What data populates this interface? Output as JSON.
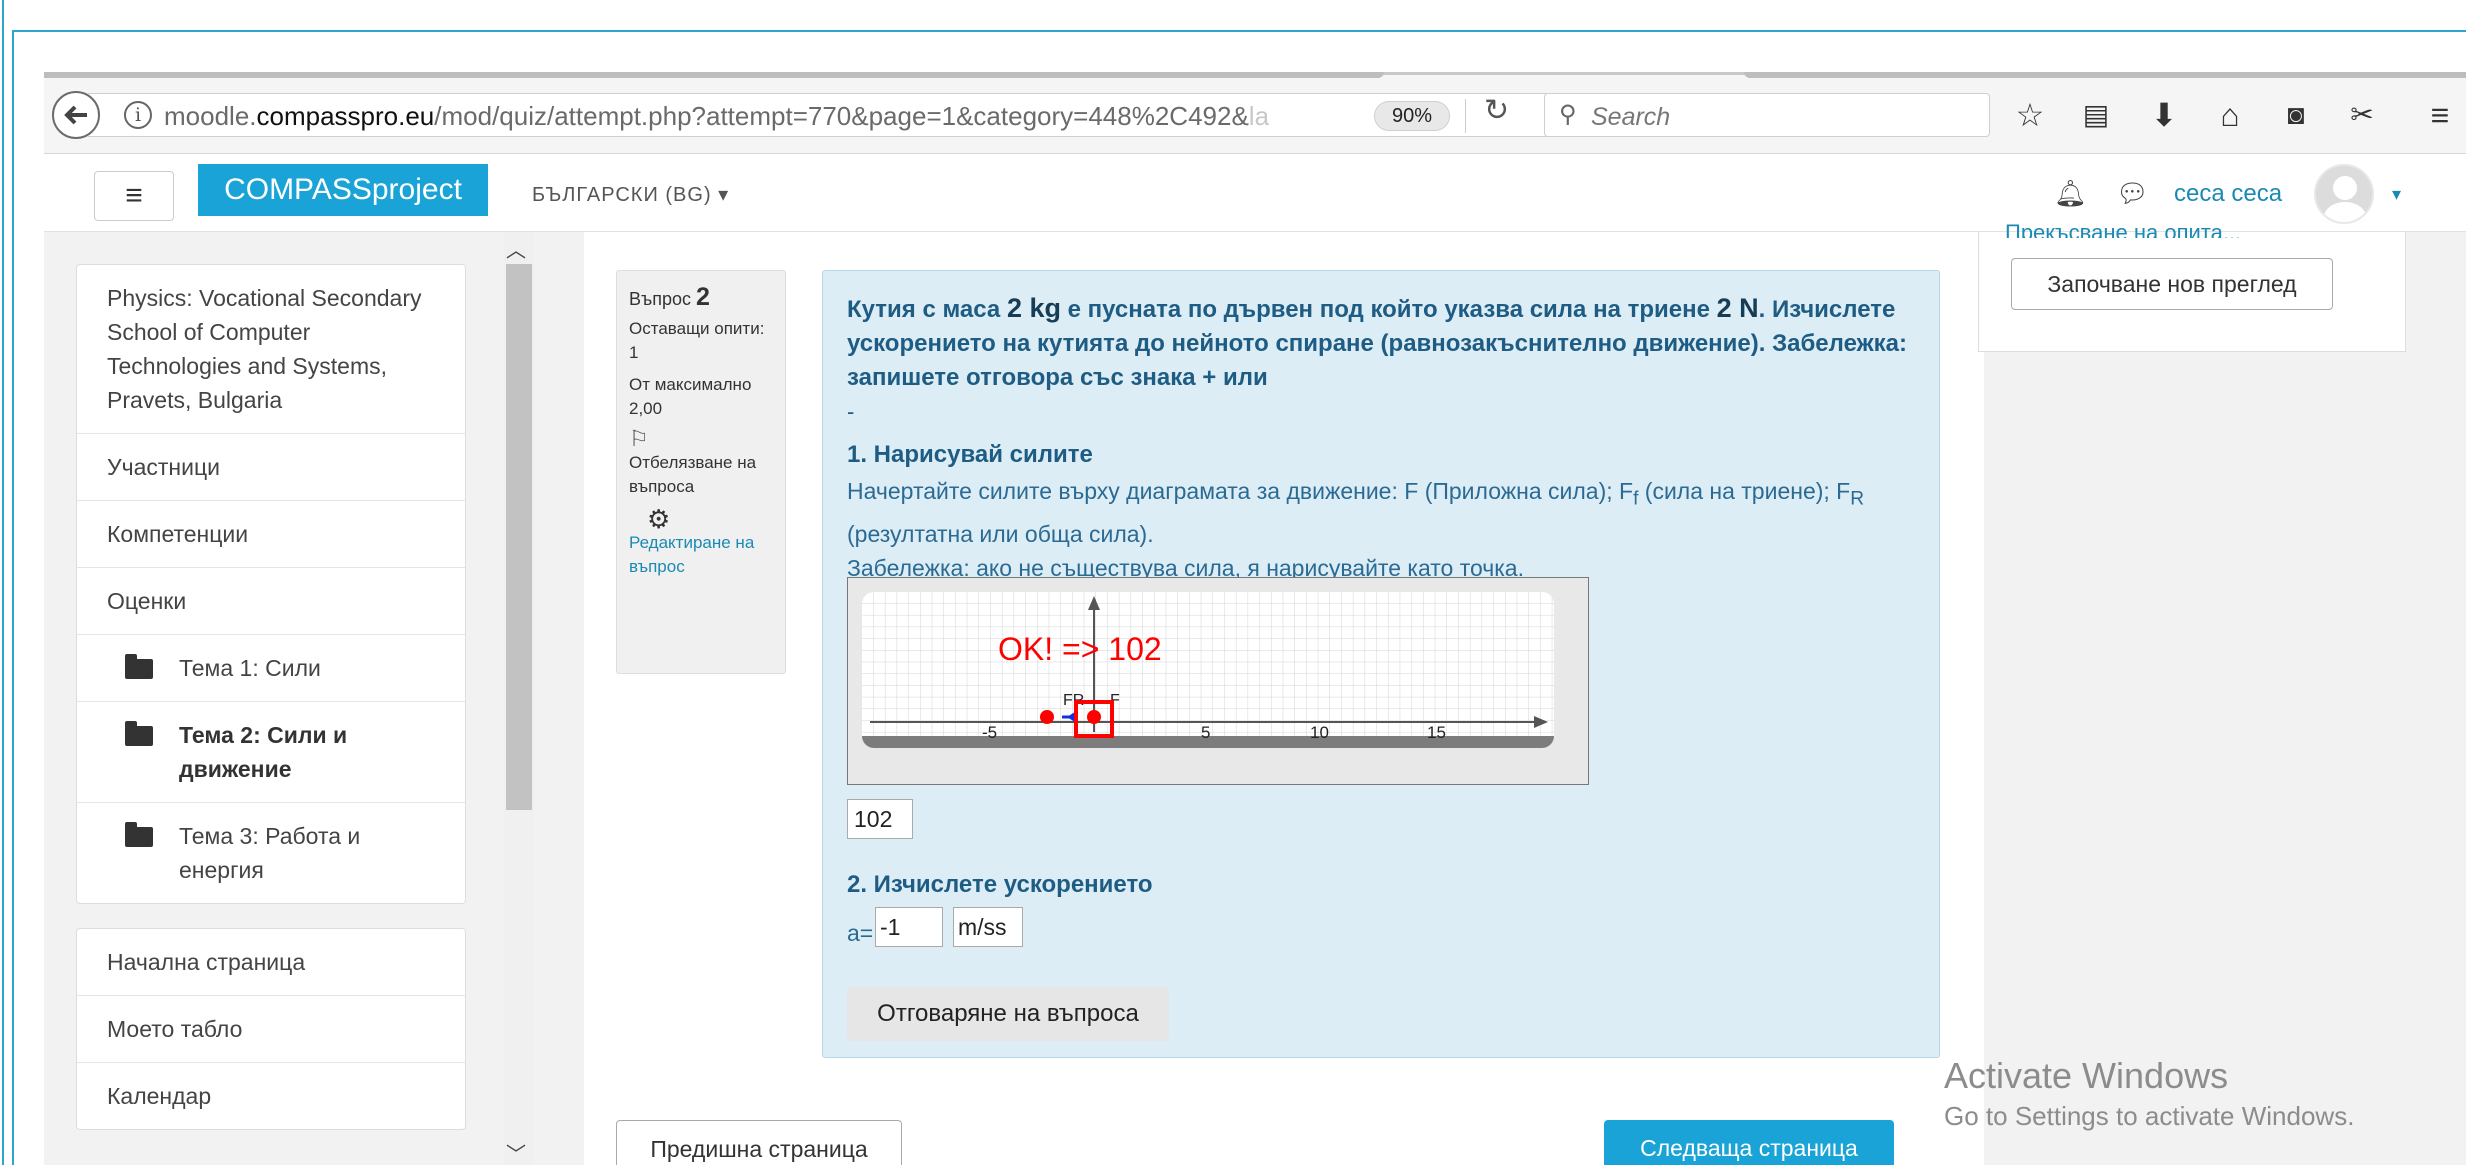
{
  "browser": {
    "url_domain_prefix": "moodle.",
    "url_domain": "compasspro.eu",
    "url_path": "/mod/quiz/attempt.php?attempt=770&page=1&category=448%2C492&",
    "url_faded": "la",
    "zoom": "90%",
    "search_placeholder": "Search"
  },
  "navbar": {
    "brand": "COMPASSproject",
    "language": "БЪЛГАРСКИ (BG) ▾",
    "user_name": "сеса сеса"
  },
  "sidebar": {
    "course_items": [
      {
        "label": "Physics: Vocational Secondary School of Computer Technologies and Systems, Pravets, Bulgaria"
      },
      {
        "label": "Участници"
      },
      {
        "label": "Компетенции"
      },
      {
        "label": "Оценки"
      },
      {
        "label": "Тема 1: Сили"
      },
      {
        "label": "Тема 2: Сили и движение"
      },
      {
        "label": "Тема 3: Работа и енергия"
      }
    ],
    "site_items": [
      {
        "label": "Начална страница"
      },
      {
        "label": "Моето табло"
      },
      {
        "label": "Календар"
      }
    ]
  },
  "question_info": {
    "label": "Въпрос",
    "number": "2",
    "attempts": "Оставащи опити: 1",
    "max_mark": "От максимално 2,00",
    "flag": "Отбелязване на въпроса",
    "edit": "Редактиране на въпрос"
  },
  "question": {
    "t1": "Кутия с маса ",
    "mass": "2 kg",
    "t2": " е пусната по дървен под който указва сила на триене ",
    "force": "2 N",
    "t3": ". Изчислете ускорението на кутията до нейното спиране (равнозакъснително движение). Забележка: запишете отговора със знака + или",
    "dash": "-",
    "sec1_title": "1. Нарисувай силите",
    "instr_a": "Начертайте силите върху диаграмата за движение: F (Приложна сила); F",
    "instr_sub_f": "f",
    "instr_b": " (сила на триене); F",
    "instr_sub_r": "R",
    "instr_c": " (резултатна или обща сила).",
    "instr_note": "Забележка: ако не съществува сила, я нарисувайте като точка.",
    "graph_message": "OK! => 102",
    "graph_label_fr": "FR",
    "graph_label_f": "F",
    "graph_ticks": [
      "-5",
      "5",
      "10",
      "15"
    ],
    "answer1": "102",
    "sec2_title": "2. Изчислете ускорението",
    "a_label": "a=",
    "a_value": "-1",
    "a_unit": "m/ss",
    "submit": "Отговаряне на въпроса"
  },
  "navigation": {
    "prev": "Предишна страница",
    "next": "Следваща страница"
  },
  "right_block": {
    "cut_text": "Прекъсване на опита...",
    "new_preview": "Започване нов преглед"
  },
  "watermark": {
    "line1": "Activate Windows",
    "line2": "Go to Settings to activate Windows."
  },
  "colors": {
    "brand": "#1aa3d6",
    "question_bg": "#dcedf5",
    "question_text": "#1e5c84",
    "graph_red": "#ff0000",
    "graph_blue": "#1030e0"
  }
}
